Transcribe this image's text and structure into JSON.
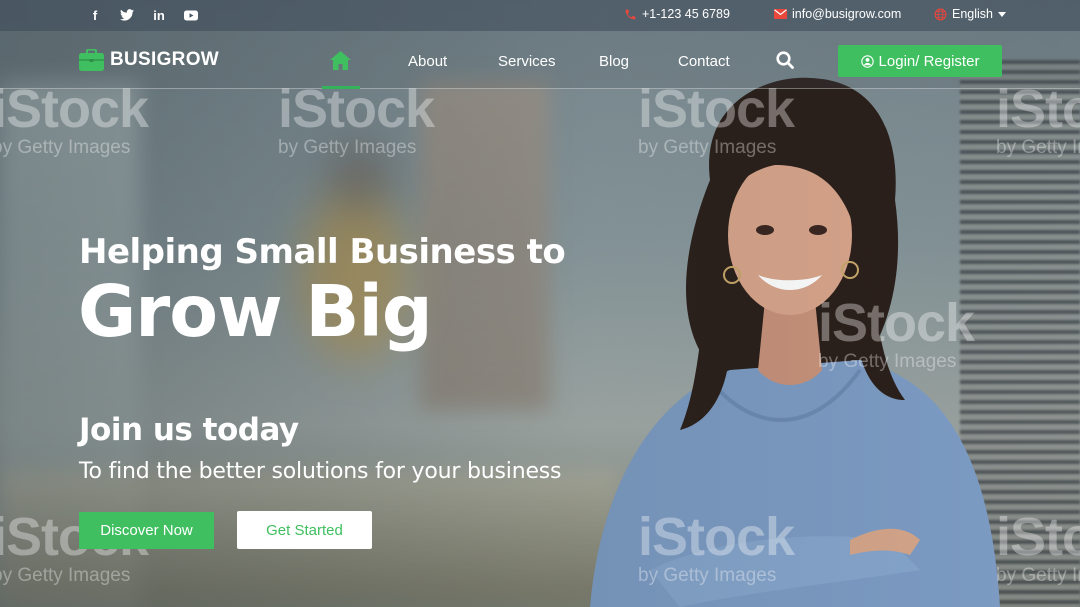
{
  "topbar": {
    "social": [
      {
        "name": "facebook",
        "glyph": "f"
      },
      {
        "name": "twitter",
        "glyph": "t"
      },
      {
        "name": "linkedin",
        "glyph": "in"
      },
      {
        "name": "youtube",
        "glyph": "▶"
      }
    ],
    "phone": "+1-123 45 6789",
    "email": "info@busigrow.com",
    "language": "English"
  },
  "nav": {
    "brand": "BUSIGROW",
    "items": [
      {
        "label": "About"
      },
      {
        "label": "Services"
      },
      {
        "label": "Blog"
      },
      {
        "label": "Contact"
      }
    ],
    "login_label": "Login/ Register"
  },
  "hero": {
    "subtitle": "Helping Small Business to",
    "title": "Grow Big",
    "join": "Join us today",
    "tagline": "To find the better solutions for your business",
    "primary_button": "Discover Now",
    "secondary_button": "Get Started"
  },
  "watermark": {
    "brand": "iStock",
    "byline": "by Getty Images"
  },
  "colors": {
    "accent": "#3fbf5f",
    "topbar": "#3e4b58",
    "icon_red": "#e8473c"
  }
}
